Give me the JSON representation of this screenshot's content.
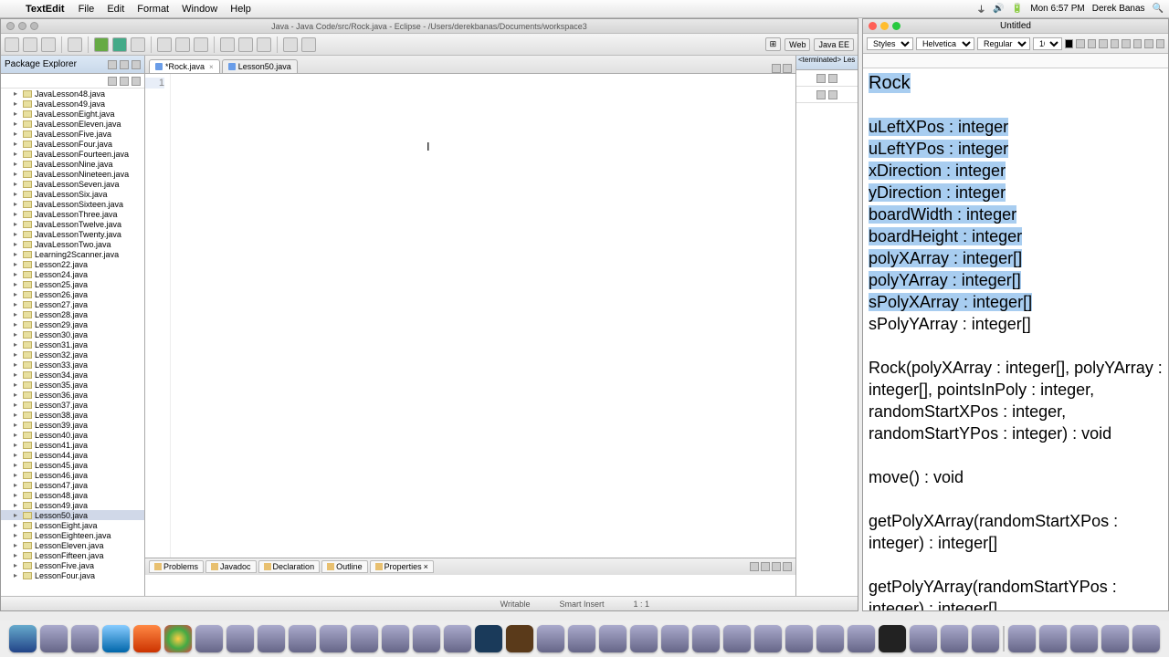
{
  "menubar": {
    "app": "TextEdit",
    "items": [
      "File",
      "Edit",
      "Format",
      "Window",
      "Help"
    ],
    "clock": "Mon 6:57 PM",
    "user": "Derek Banas"
  },
  "eclipse": {
    "title": "Java - Java Code/src/Rock.java - Eclipse - /Users/derekbanas/Documents/workspace3",
    "perspectives": [
      "Web",
      "Java EE"
    ],
    "package_explorer": {
      "title": "Package Explorer",
      "files": [
        "JavaLesson48.java",
        "JavaLesson49.java",
        "JavaLessonEight.java",
        "JavaLessonEleven.java",
        "JavaLessonFive.java",
        "JavaLessonFour.java",
        "JavaLessonFourteen.java",
        "JavaLessonNine.java",
        "JavaLessonNineteen.java",
        "JavaLessonSeven.java",
        "JavaLessonSix.java",
        "JavaLessonSixteen.java",
        "JavaLessonThree.java",
        "JavaLessonTwelve.java",
        "JavaLessonTwenty.java",
        "JavaLessonTwo.java",
        "Learning2Scanner.java",
        "Lesson22.java",
        "Lesson24.java",
        "Lesson25.java",
        "Lesson26.java",
        "Lesson27.java",
        "Lesson28.java",
        "Lesson29.java",
        "Lesson30.java",
        "Lesson31.java",
        "Lesson32.java",
        "Lesson33.java",
        "Lesson34.java",
        "Lesson35.java",
        "Lesson36.java",
        "Lesson37.java",
        "Lesson38.java",
        "Lesson39.java",
        "Lesson40.java",
        "Lesson41.java",
        "Lesson44.java",
        "Lesson45.java",
        "Lesson46.java",
        "Lesson47.java",
        "Lesson48.java",
        "Lesson49.java",
        "Lesson50.java",
        "LessonEight.java",
        "LessonEighteen.java",
        "LessonEleven.java",
        "LessonFifteen.java",
        "LessonFive.java",
        "LessonFour.java"
      ],
      "selected": "Lesson50.java"
    },
    "tabs": [
      {
        "label": "*Rock.java",
        "active": true
      },
      {
        "label": "Lesson50.java",
        "active": false
      }
    ],
    "gutter_line": "1",
    "outline_header": "<terminated> Les",
    "bottom_tabs": [
      "Problems",
      "Javadoc",
      "Declaration",
      "Outline",
      "Properties"
    ],
    "status": {
      "writable": "Writable",
      "insert": "Smart Insert",
      "pos": "1 : 1"
    }
  },
  "textedit": {
    "title": "Untitled",
    "font_family": "Helvetica",
    "font_style": "Regular",
    "font_size": "10",
    "doc": {
      "class_name": "Rock",
      "fields": [
        "uLeftXPos : integer",
        "uLeftYPos : integer",
        "xDirection : integer",
        "yDirection : integer",
        "boardWidth : integer",
        "boardHeight : integer",
        "polyXArray : integer[]",
        "polyYArray : integer[]",
        "sPolyXArray : integer[]"
      ],
      "field_unselected": "sPolyYArray : integer[]",
      "constructor": "Rock(polyXArray : integer[], polyYArray : integer[], pointsInPoly : integer, randomStartXPos : integer, randomStartYPos : integer) : void",
      "method1": "move() : void",
      "method2": "getPolyXArray(randomStartXPos : integer) : integer[]",
      "method3": "getPolyYArray(randomStartYPos : integer) : integer[]"
    }
  }
}
